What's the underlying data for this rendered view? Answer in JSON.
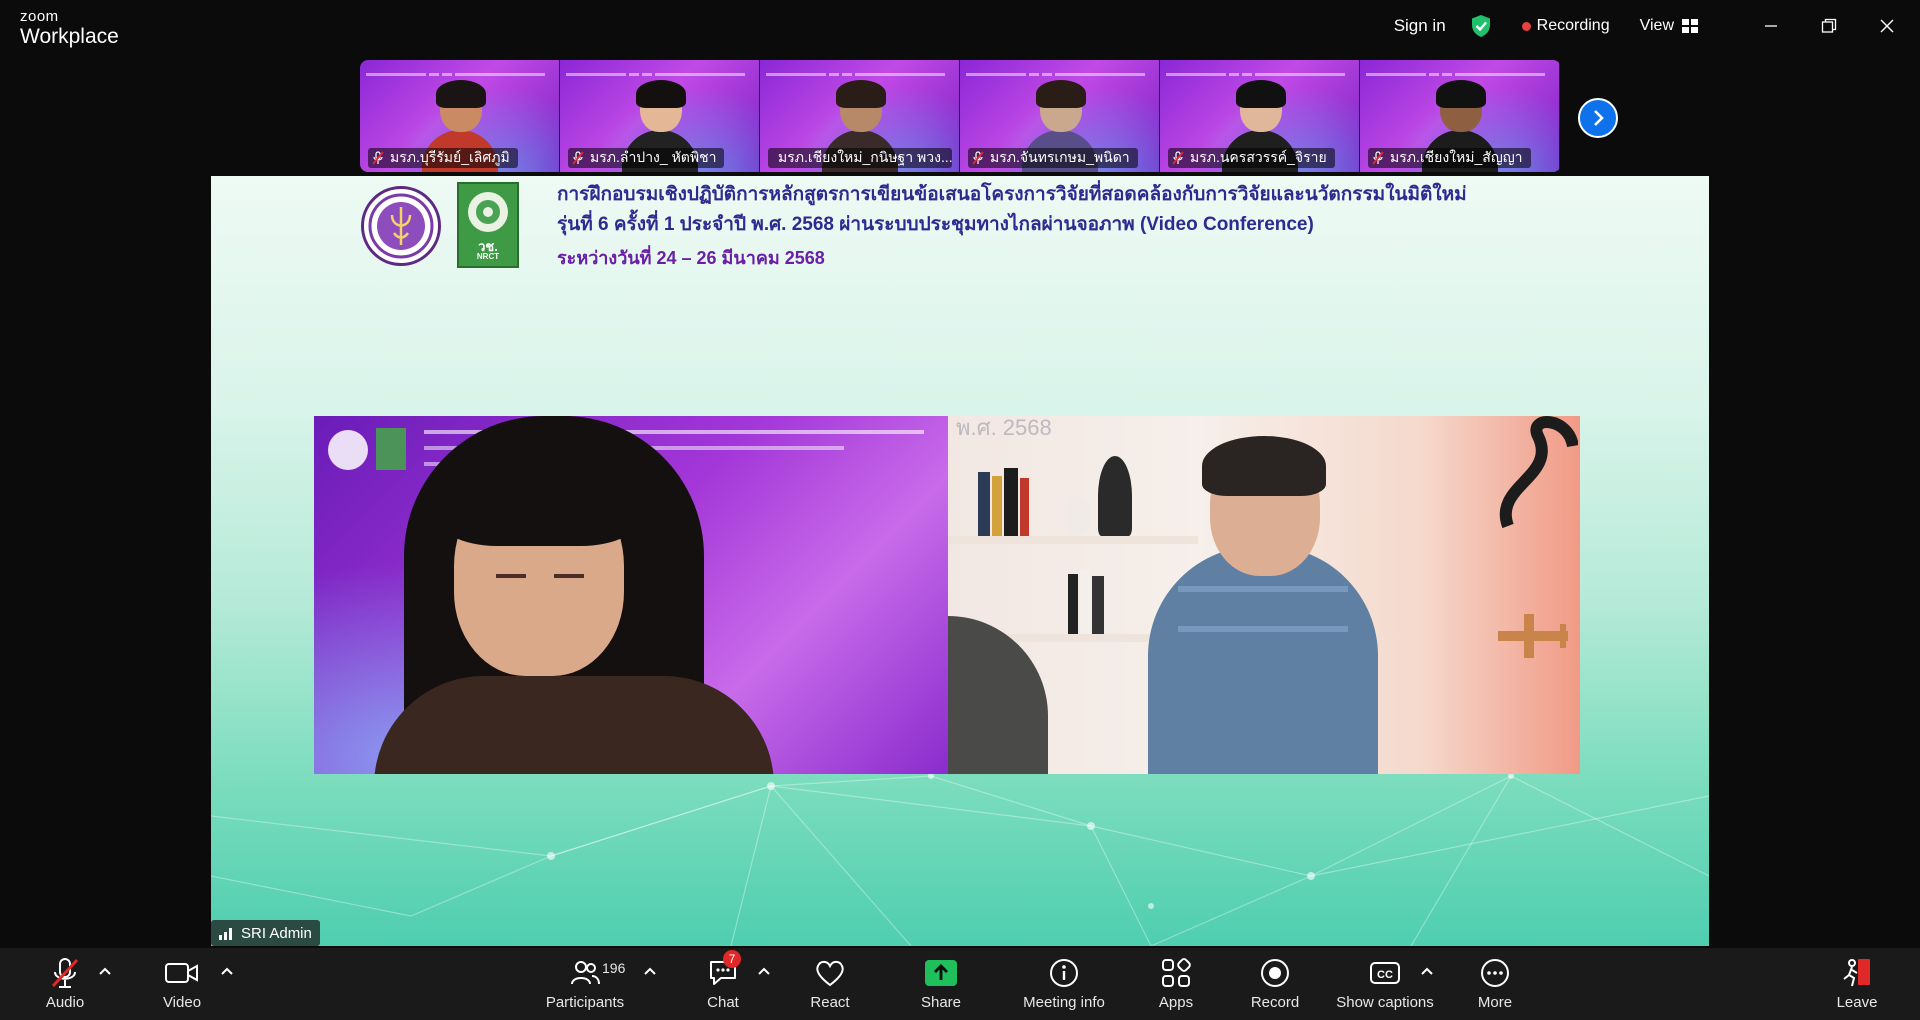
{
  "app": {
    "brand_top": "zoom",
    "brand_bottom": "Workplace"
  },
  "titlebar": {
    "sign_in": "Sign in",
    "recording": "Recording",
    "view": "View",
    "colors": {
      "recording_dot": "#e8403a",
      "shield": "#21c06a"
    }
  },
  "thumbnails": [
    {
      "name": "มรภ.บุรีรัมย์_เลิศภูมิ",
      "skin": "#c98a64",
      "shirt": "#c0392b",
      "hair": "#1b1414"
    },
    {
      "name": "มรภ.ลำปาง_ หัตพิชา",
      "skin": "#e4b896",
      "shirt": "#222222",
      "hair": "#151010"
    },
    {
      "name": "มรภ.เชียงใหม่_กนิษฐา พวง...",
      "skin": "#b88968",
      "shirt": "#3a2a2a",
      "hair": "#2a1c16"
    },
    {
      "name": "มรภ.จันทรเกษม_พนิดา",
      "skin": "#c9a88e",
      "shirt": "#5a4e8a",
      "hair": "#2a1c16"
    },
    {
      "name": "มรภ.นครสวรรค์_จิราย",
      "skin": "#e0b79a",
      "shirt": "#1f1f1f",
      "hair": "#111111"
    },
    {
      "name": "มรภ.เชียงใหม่_สัญญา",
      "skin": "#8f5f42",
      "shirt": "#1c1c1c",
      "hair": "#111111"
    }
  ],
  "content": {
    "headline_line1": "การฝึกอบรมเชิงปฏิบัติการหลักสูตรการเขียนข้อเสนอโครงการวิจัยที่สอดคล้องกับการวิจัยและนวัตกรรมในมิติใหม่",
    "headline_line2": "รุ่นที่ 6 ครั้งที่ 1 ประจำปี พ.ศ. 2568 ผ่านระบบประชุมทางไกลผ่านจอภาพ (Video Conference)",
    "headline_line3": "ระหว่างวันที่ 24 – 26 มีนาคม 2568",
    "logo2_text": "วช.",
    "logo2_sub": "NRCT",
    "video2_overlay": "พ.ศ. 2568",
    "speaker_label": "SRI Admin"
  },
  "toolbar": {
    "audio": "Audio",
    "video": "Video",
    "participants": "Participants",
    "participants_count": "196",
    "chat": "Chat",
    "chat_badge": "7",
    "react": "React",
    "share": "Share",
    "meeting_info": "Meeting info",
    "apps": "Apps",
    "record": "Record",
    "captions": "Show captions",
    "more": "More",
    "leave": "Leave",
    "colors": {
      "share_green": "#1fbf5b",
      "leave_red": "#e02828",
      "badge": "#e02828"
    }
  }
}
